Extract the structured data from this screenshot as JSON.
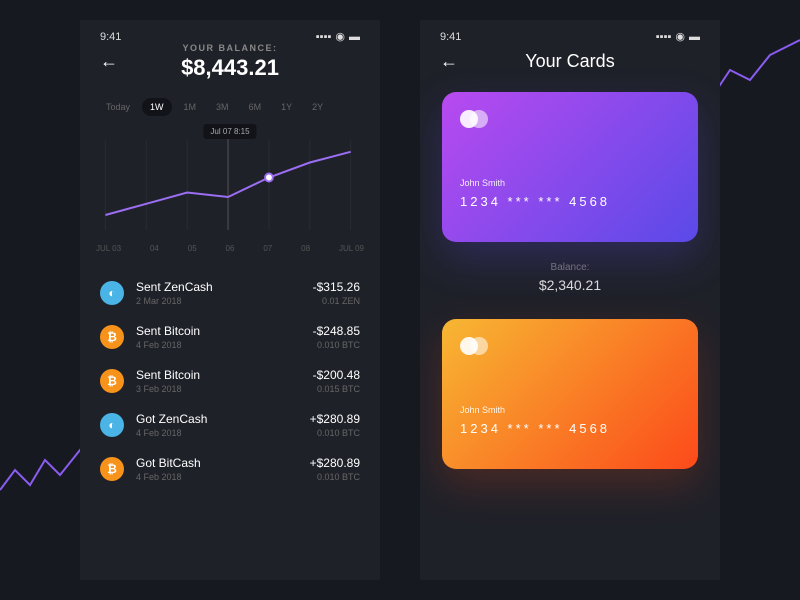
{
  "status": {
    "time": "9:41"
  },
  "balance_screen": {
    "label": "YOUR BALANCE:",
    "amount": "$8,443.21",
    "ranges": [
      "Today",
      "1W",
      "1M",
      "3M",
      "6M",
      "1Y",
      "2Y"
    ],
    "active_range": "1W",
    "tooltip": "Jul 07 8:15",
    "x_labels": [
      "JUL 03",
      "04",
      "05",
      "06",
      "07",
      "08",
      "JUL 09"
    ],
    "transactions": [
      {
        "icon": "zen",
        "title": "Sent ZenCash",
        "date": "2 Mar 2018",
        "amount": "-$315.26",
        "unit": "0.01 ZEN"
      },
      {
        "icon": "btc",
        "title": "Sent Bitcoin",
        "date": "4 Feb 2018",
        "amount": "-$248.85",
        "unit": "0.010 BTC"
      },
      {
        "icon": "btc",
        "title": "Sent Bitcoin",
        "date": "3 Feb 2018",
        "amount": "-$200.48",
        "unit": "0.015 BTC"
      },
      {
        "icon": "zen",
        "title": "Got ZenCash",
        "date": "4 Feb 2018",
        "amount": "+$280.89",
        "unit": "0.010 BTC"
      },
      {
        "icon": "btc",
        "title": "Got BitCash",
        "date": "4 Feb 2018",
        "amount": "+$280.89",
        "unit": "0.010 BTC"
      }
    ]
  },
  "cards_screen": {
    "title": "Your Cards",
    "cards": [
      {
        "name": "John Smith",
        "number": "1234   ***   ***   4568",
        "variant": "purple"
      },
      {
        "name": "John Smith",
        "number": "1234   ***   ***   4568",
        "variant": "orange"
      }
    ],
    "balance_label": "Balance:",
    "balance_amount": "$2,340.21"
  },
  "chart_data": {
    "type": "line",
    "title": "Balance (1W)",
    "x": [
      "JUL 03",
      "04",
      "05",
      "06",
      "07",
      "08",
      "JUL 09"
    ],
    "series": [
      {
        "name": "balance",
        "values": [
          7600,
          7750,
          7900,
          7840,
          8100,
          8300,
          8443
        ]
      }
    ],
    "ylim": [
      7400,
      8600
    ],
    "marker_x": "07",
    "marker_label": "Jul 07 8:15"
  }
}
